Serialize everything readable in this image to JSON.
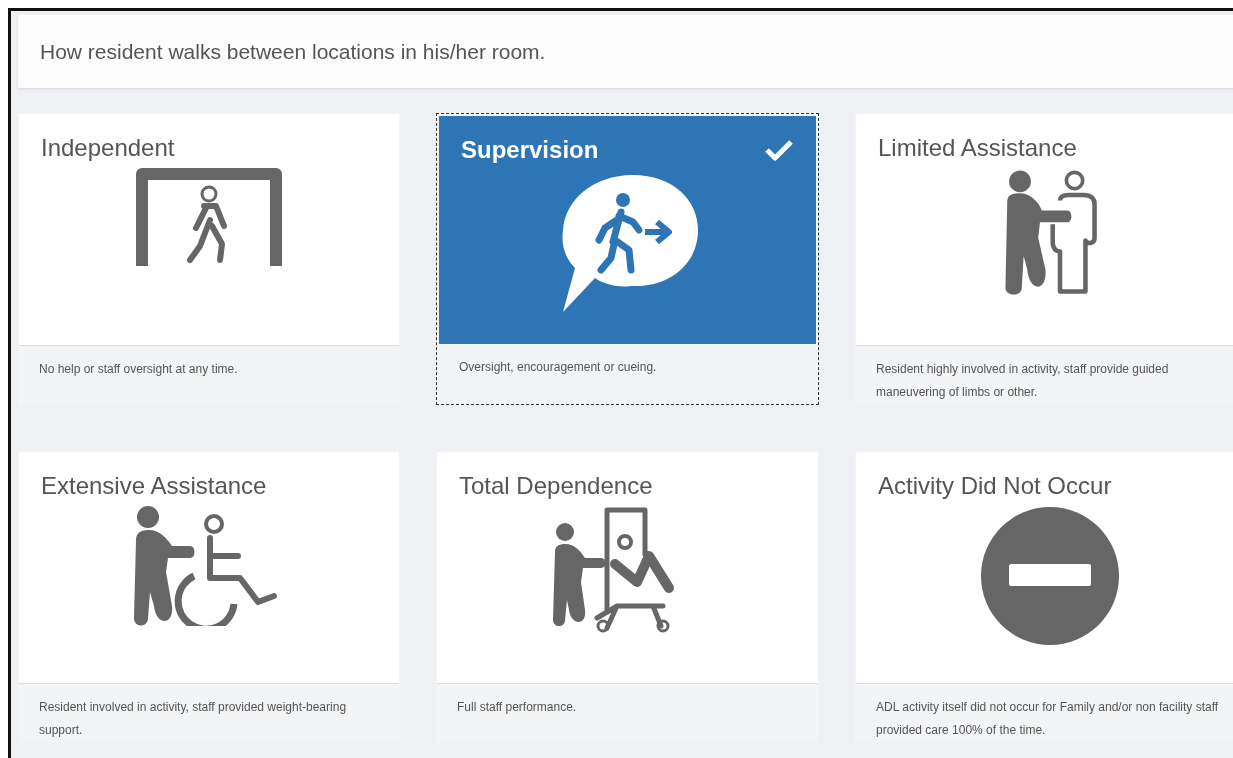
{
  "question": "How resident walks between locations in his/her room.",
  "options": [
    {
      "title": "Independent",
      "kind": "door",
      "description": "No help or staff oversight at any time.",
      "selected": false
    },
    {
      "title": "Supervision",
      "kind": "speech",
      "description": "Oversight, encouragement or cueing.",
      "selected": true
    },
    {
      "title": "Limited Assistance",
      "kind": "helper",
      "description": "Resident highly involved in activity, staff provide guided maneuvering of limbs or other.",
      "selected": false
    },
    {
      "title": "Extensive Assistance",
      "kind": "wheelchair",
      "description": "Resident involved in activity, staff provided weight-bearing support.",
      "selected": false
    },
    {
      "title": "Total Dependence",
      "kind": "stretcher",
      "description": "Full staff performance.",
      "selected": false
    },
    {
      "title": "Activity Did Not Occur",
      "kind": "blocked",
      "description": "ADL activity itself did not occur for Family and/or non facility staff provided care 100% of the time.",
      "selected": false
    }
  ]
}
